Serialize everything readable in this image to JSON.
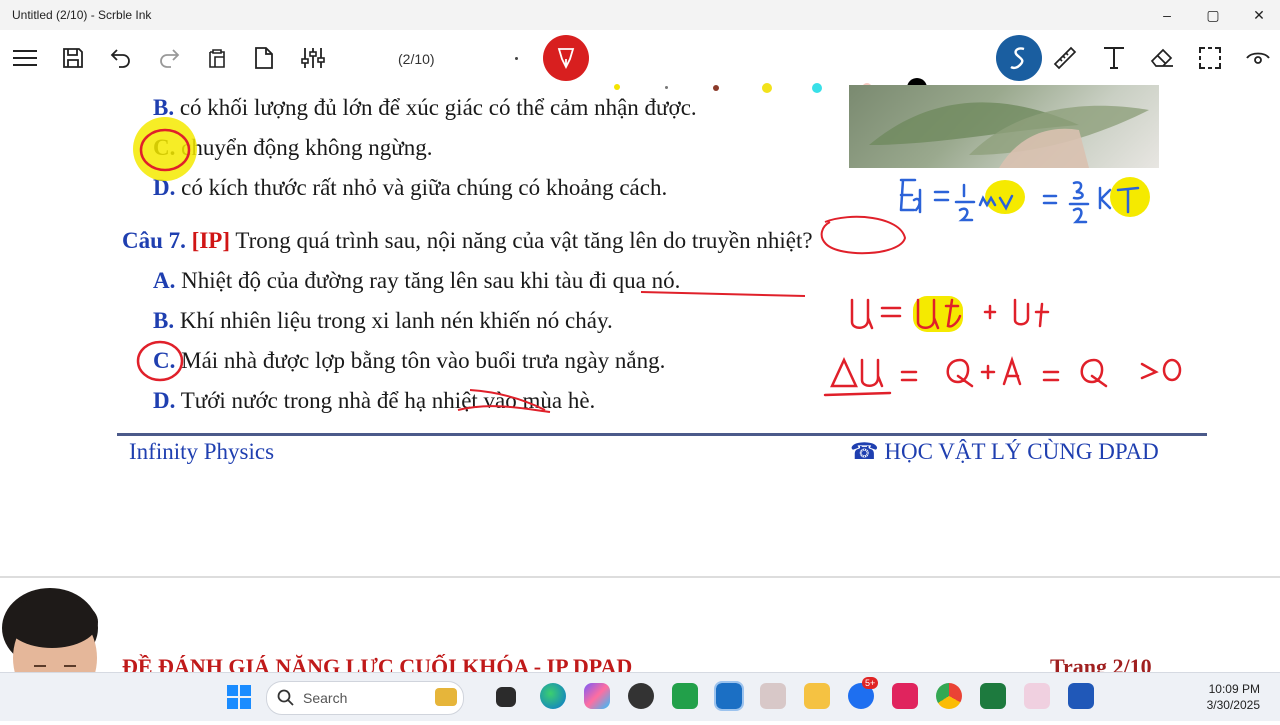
{
  "window": {
    "title": "Untitled (2/10) - Scrble Ink",
    "minimize": "–",
    "maximize": "▢",
    "close": "✕"
  },
  "toolbar": {
    "page_indicator": "(2/10)",
    "icons": [
      "menu-icon",
      "save-icon",
      "undo-icon",
      "redo-icon",
      "clipboard-icon",
      "new-page-icon",
      "settings-sliders-icon",
      "pen-icon",
      "smart-ink-icon",
      "ruler-icon",
      "text-icon",
      "eraser-icon",
      "select-icon",
      "view-icon"
    ],
    "pen_colors": [
      "#444444",
      "#f4e400",
      "#777777",
      "#8b3a2a",
      "#f2e21b",
      "#38e0e8",
      "#f5c9c0",
      "#000000",
      "#555555"
    ],
    "pen_active_color": "#d81f1f",
    "smart_ink_color": "#1a5ea0"
  },
  "question6": {
    "option_b_label": "B.",
    "option_b_text": "có khối lượng đủ lớn để xúc giác có thể cảm nhận được.",
    "option_c_label": "C.",
    "option_c_text": "chuyển động không ngừng.",
    "option_d_label": "D.",
    "option_d_text": "có kích thước rất nhỏ và giữa chúng có khoảng cách."
  },
  "question7": {
    "number": "Câu 7.",
    "tag": "[IP]",
    "prompt": "Trong quá trình sau, nội năng của vật tăng lên do truyền nhiệt?",
    "option_a_label": "A.",
    "option_a_text": "Nhiệt độ của đường ray tăng lên sau khi tàu đi qua nó.",
    "option_b_label": "B.",
    "option_b_text": "Khí nhiên liệu trong xi lanh nén khiến nó cháy.",
    "option_c_label": "C.",
    "option_c_text": "Mái nhà được lợp bằng tôn vào buổi trưa ngày nắng.",
    "option_d_label": "D.",
    "option_d_text": "Tưới nước trong nhà để hạ nhiệt vào mùa hè."
  },
  "footer": {
    "left": "Infinity Physics",
    "right": "☎ HỌC VẬT LÝ CÙNG DPAD"
  },
  "next_page": {
    "title": "ĐỀ ĐÁNH GIÁ NĂNG LỰC CUỐI KHÓA - IP DPAD",
    "page": "Trang 2/10"
  },
  "annotations": {
    "ink_color": "#e0202a",
    "eq_color": "#2b62d8",
    "highlight": "#f5ea00",
    "eq1": "Eđ = ½ mv² = 3/2 kT",
    "eq2": "U = Uđ + Ut",
    "eq3": "ΔU = Q + A = Q > 0"
  },
  "taskbar": {
    "search_placeholder": "Search",
    "time": "10:09 PM",
    "date": "3/30/2025",
    "zalo_badge": "5+"
  }
}
